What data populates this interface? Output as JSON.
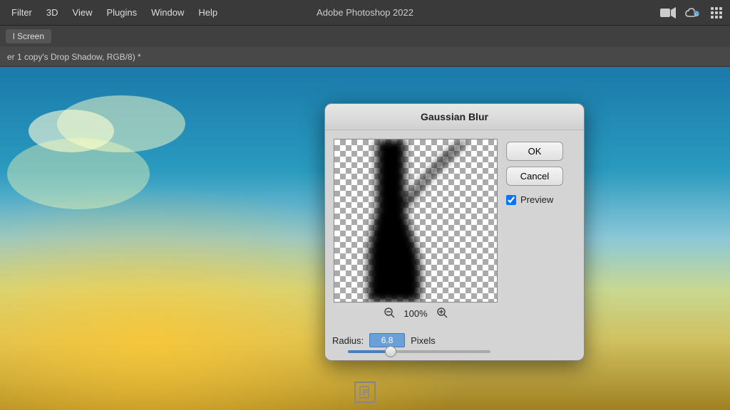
{
  "app": {
    "title": "Adobe Photoshop 2022"
  },
  "menubar": {
    "items": [
      "Filter",
      "3D",
      "View",
      "Plugins",
      "Window",
      "Help"
    ]
  },
  "tabbar": {
    "screen_btn": "l Screen"
  },
  "doctitle": {
    "text": "er 1 copy's Drop Shadow, RGB/8) *"
  },
  "dialog": {
    "title": "Gaussian Blur",
    "ok_label": "OK",
    "cancel_label": "Cancel",
    "preview_label": "Preview",
    "preview_checked": true,
    "zoom_out_icon": "🔍",
    "zoom_in_icon": "🔍",
    "zoom_value": "100%",
    "radius_label": "Radius:",
    "radius_value": "6.8",
    "radius_unit": "Pixels"
  },
  "bottom": {
    "icon_label": "document-icon"
  }
}
